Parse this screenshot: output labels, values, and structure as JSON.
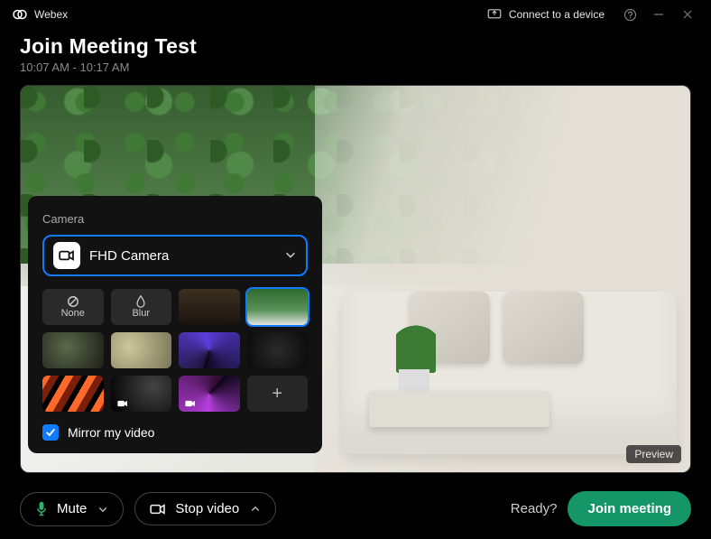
{
  "app_title": "Webex",
  "connect_device_label": "Connect to a device",
  "meeting_title": "Join Meeting Test",
  "meeting_subtitle": "10:07 AM - 10:17 AM",
  "preview_badge": "Preview",
  "camera_panel": {
    "label": "Camera",
    "selected_camera": "FHD Camera",
    "bg_none_label": "None",
    "bg_blur_label": "Blur",
    "add_label": "+",
    "mirror_label": "Mirror my video",
    "mirror_checked": true
  },
  "controls": {
    "mute_label": "Mute",
    "stop_video_label": "Stop video",
    "ready_label": "Ready?",
    "join_label": "Join meeting"
  }
}
